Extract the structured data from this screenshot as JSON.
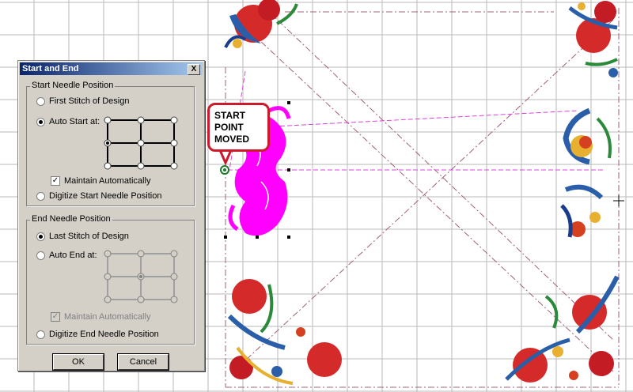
{
  "dialog": {
    "title": "Start and End",
    "close_label": "X",
    "start_group": {
      "title": "Start Needle Position",
      "option_first_stitch": "First Stitch of Design",
      "option_auto_start": "Auto Start at:",
      "maintain_label": "Maintain Automatically",
      "maintain_checked": true,
      "option_digitize_start": "Digitize Start Needle Position",
      "selected": "auto_start"
    },
    "end_group": {
      "title": "End Needle Position",
      "option_last_stitch": "Last Stitch of Design",
      "option_auto_end": "Auto End at:",
      "maintain_label": "Maintain Automatically",
      "option_digitize_end": "Digitize End Needle Position",
      "selected": "last_stitch"
    },
    "ok_label": "OK",
    "cancel_label": "Cancel"
  },
  "callout": {
    "line1": "START",
    "line2": "POINT",
    "line3": "MOVED"
  },
  "colors": {
    "arrow": "#e8141c",
    "magenta": "#ff00ff",
    "callout_border": "#cc1a2a",
    "grid": "#b4b4b4"
  }
}
